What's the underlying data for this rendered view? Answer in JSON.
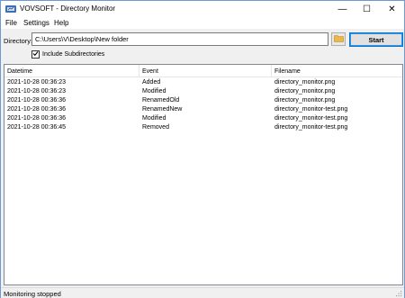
{
  "window": {
    "title": "VOVSOFT - Directory Monitor",
    "app_icon": "folder-monitor-icon",
    "minimize_glyph": "—",
    "maximize_glyph": "☐",
    "close_glyph": "✕"
  },
  "menu": {
    "file": "File",
    "settings": "Settings",
    "help": "Help"
  },
  "directory": {
    "label": "Directory:",
    "value": "C:\\Users\\V\\Desktop\\New folder",
    "browse_icon": "folder-icon"
  },
  "start_button": "Start",
  "include_subdirectories": {
    "label": "Include Subdirectories",
    "checked": true
  },
  "table": {
    "columns": [
      "Datetime",
      "Event",
      "Filename"
    ],
    "rows": [
      [
        "2021-10-28 00:36:23",
        "Added",
        "directory_monitor.png"
      ],
      [
        "2021-10-28 00:36:23",
        "Modified",
        "directory_monitor.png"
      ],
      [
        "2021-10-28 00:36:36",
        "RenamedOld",
        "directory_monitor.png"
      ],
      [
        "2021-10-28 00:36:36",
        "RenamedNew",
        "directory_monitor-test.png"
      ],
      [
        "2021-10-28 00:36:36",
        "Modified",
        "directory_monitor-test.png"
      ],
      [
        "2021-10-28 00:36:45",
        "Removed",
        "directory_monitor-test.png"
      ]
    ]
  },
  "status": "Monitoring stopped",
  "colors": {
    "accent": "#0078d7",
    "window_border": "#6d9ad6",
    "folder_yellow": "#e8b84a"
  }
}
